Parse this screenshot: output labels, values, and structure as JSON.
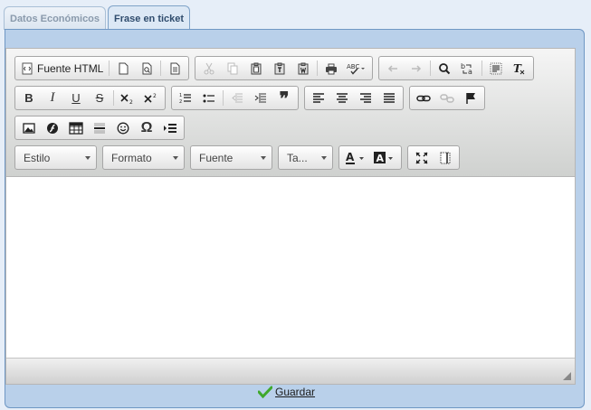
{
  "tabs": [
    {
      "label": "Datos Económicos",
      "active": false
    },
    {
      "label": "Frase en ticket",
      "active": true
    }
  ],
  "toolbar": {
    "source_label": "Fuente HTML",
    "combos": {
      "styles": "Estilo",
      "format": "Formato",
      "font": "Fuente",
      "size": "Ta..."
    },
    "buttons": {
      "bold": "B",
      "italic": "I",
      "underline": "U",
      "strike": "S",
      "special_char": "Ω",
      "blockquote": "❞"
    }
  },
  "editor": {
    "content": ""
  },
  "actions": {
    "save_label": "Guardar"
  },
  "colors": {
    "accent": "#6f97c4",
    "panel": "#b9d0ea",
    "save_check": "#3fa82c"
  }
}
